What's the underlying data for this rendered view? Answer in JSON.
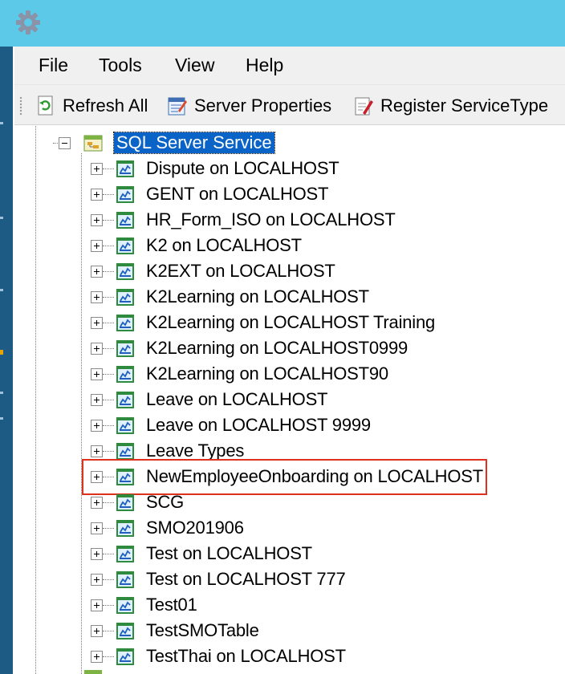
{
  "menu": {
    "file": "File",
    "tools": "Tools",
    "view": "View",
    "help": "Help"
  },
  "toolbar": {
    "refresh_all": "Refresh All",
    "server_properties": "Server Properties",
    "register_service_type": "Register ServiceType"
  },
  "tree": {
    "root_label": "SQL Server Service",
    "root_selected": true,
    "items": [
      {
        "label": "Dispute on LOCALHOST"
      },
      {
        "label": "GENT on LOCALHOST"
      },
      {
        "label": "HR_Form_ISO on LOCALHOST"
      },
      {
        "label": "K2 on LOCALHOST"
      },
      {
        "label": "K2EXT on LOCALHOST"
      },
      {
        "label": "K2Learning on LOCALHOST"
      },
      {
        "label": "K2Learning on LOCALHOST Training"
      },
      {
        "label": "K2Learning on LOCALHOST0999"
      },
      {
        "label": "K2Learning on LOCALHOST90"
      },
      {
        "label": "Leave on LOCALHOST"
      },
      {
        "label": "Leave on LOCALHOST 9999"
      },
      {
        "label": "Leave Types"
      },
      {
        "label": "NewEmployeeOnboarding on LOCALHOST",
        "highlighted": true
      },
      {
        "label": "SCG"
      },
      {
        "label": "SMO201906"
      },
      {
        "label": "Test on LOCALHOST"
      },
      {
        "label": "Test on LOCALHOST 777"
      },
      {
        "label": "Test01"
      },
      {
        "label": "TestSMOTable"
      },
      {
        "label": "TestThai on LOCALHOST"
      }
    ]
  },
  "colors": {
    "titlebar": "#5cc9e8",
    "selection": "#0a63c6",
    "highlight_border": "#e0301e"
  }
}
